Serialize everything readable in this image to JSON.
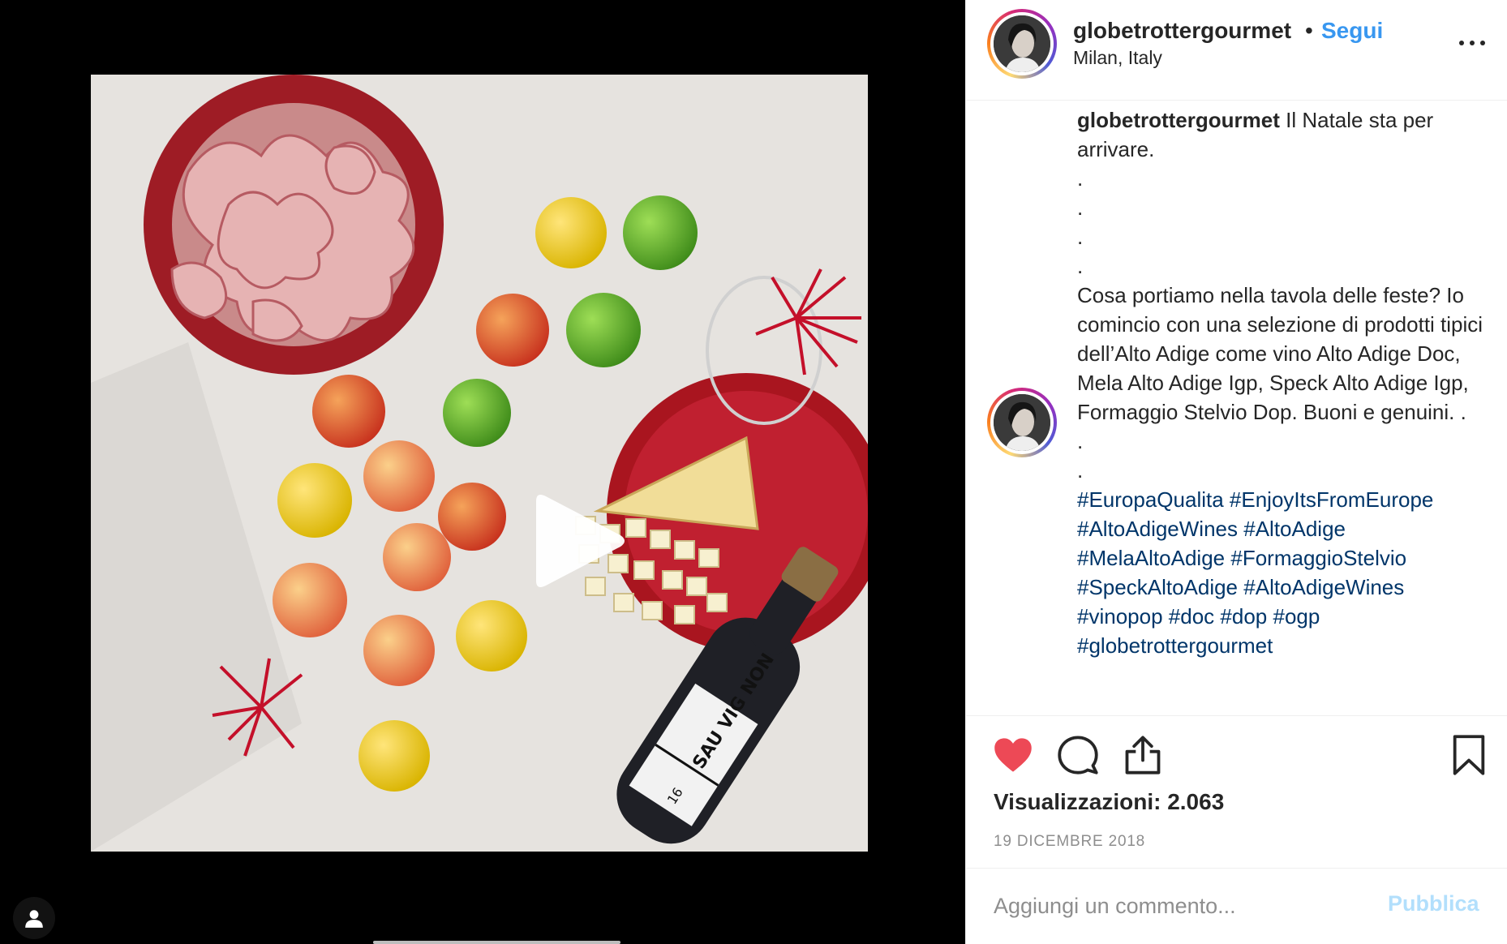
{
  "post": {
    "username": "globetrottergourmet",
    "separator": "•",
    "follow_label": "Segui",
    "location": "Milan, Italy"
  },
  "caption": {
    "username": "globetrottergourmet",
    "intro": "Il Natale sta per arrivare.",
    "dots": [
      ".",
      ".",
      ".",
      "."
    ],
    "body": "Cosa portiamo nella tavola delle feste? Io comincio con una selezione di prodotti tipici dell’Alto Adige come vino Alto Adige Doc, Mela Alto Adige Igp, Speck Alto Adige Igp, Formaggio Stelvio Dop. Buoni e genuini. .",
    "dots_after": [
      ".",
      "."
    ],
    "hashtags": [
      "#EuropaQualita",
      "#EnjoyItsFromEurope",
      "#AltoAdigeWines",
      "#AltoAdige",
      "#MelaAltoAdige",
      "#FormaggioStelvio",
      "#SpeckAltoAdige",
      "#AltoAdigeWines",
      "#vinopop",
      "#doc",
      "#dop",
      "#ogp",
      "#globetrottergourmet"
    ]
  },
  "stats": {
    "views": "Visualizzazioni: 2.063",
    "date": "19 DICEMBRE 2018"
  },
  "comment": {
    "placeholder": "Aggiungi un commento...",
    "publish_label": "Pubblica"
  },
  "media": {
    "bottle_label": "SAU VIG NON",
    "bottle_year": "16"
  },
  "icons": {
    "like": "heart-icon",
    "comment": "comment-bubble-icon",
    "share": "share-icon",
    "save": "bookmark-icon",
    "more": "ellipsis-icon",
    "play": "play-icon",
    "user_tag": "user-icon"
  },
  "colors": {
    "like_red": "#ed4956",
    "follow_blue": "#3897f0",
    "hashtag_blue": "#003569",
    "publish_disabled": "#b2dffc"
  }
}
